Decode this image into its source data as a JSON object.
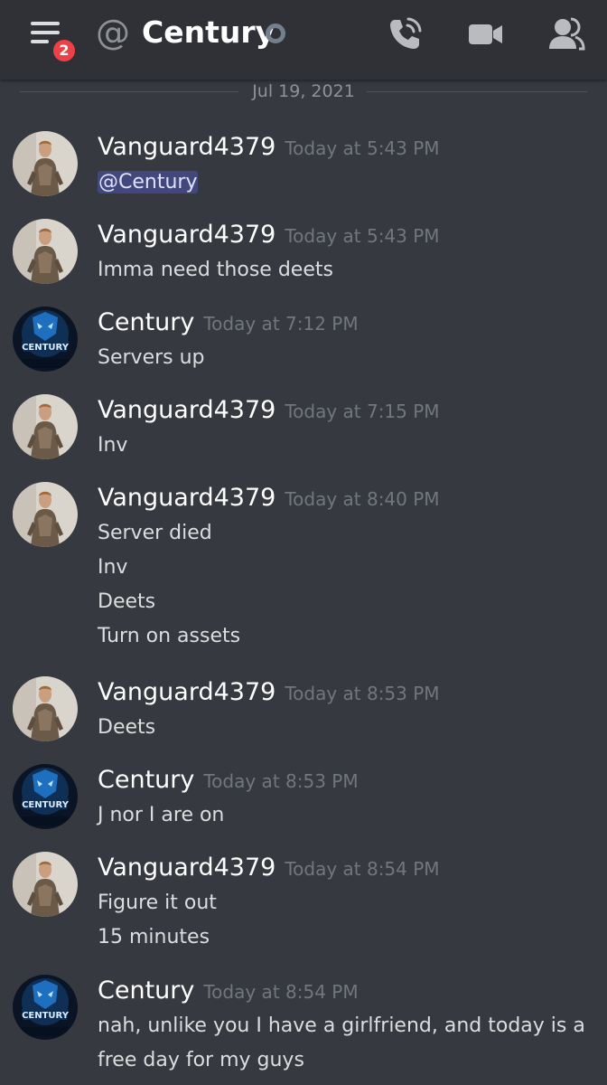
{
  "header": {
    "at_symbol": "@",
    "title": "Century",
    "badge_count": "2",
    "icons": [
      "menu-icon",
      "call-icon",
      "video-icon",
      "members-icon"
    ]
  },
  "divider": {
    "date": "Jul 19, 2021"
  },
  "messages": [
    {
      "author": "Vanguard4379",
      "avatar": "vanguard",
      "time": "Today at 5:43 PM",
      "lines": [
        "@Century"
      ]
    },
    {
      "author": "Vanguard4379",
      "avatar": "vanguard",
      "time": "Today at 5:43 PM",
      "lines": [
        "Imma need those deets"
      ]
    },
    {
      "author": "Century",
      "avatar": "century",
      "time": "Today at 7:12 PM",
      "lines": [
        "Servers up"
      ]
    },
    {
      "author": "Vanguard4379",
      "avatar": "vanguard",
      "time": "Today at 7:15 PM",
      "lines": [
        "Inv"
      ]
    },
    {
      "author": "Vanguard4379",
      "avatar": "vanguard",
      "time": "Today at 8:40 PM",
      "lines": [
        "Server died",
        "Inv",
        "Deets",
        "Turn on assets"
      ]
    },
    {
      "author": "Vanguard4379",
      "avatar": "vanguard",
      "time": "Today at 8:53 PM",
      "lines": [
        "Deets"
      ]
    },
    {
      "author": "Century",
      "avatar": "century",
      "time": "Today at 8:53 PM",
      "lines": [
        "J nor I are on"
      ]
    },
    {
      "author": "Vanguard4379",
      "avatar": "vanguard",
      "time": "Today at 8:54 PM",
      "lines": [
        "Figure it out",
        "15 minutes"
      ]
    },
    {
      "author": "Century",
      "avatar": "century",
      "time": "Today at 8:54 PM",
      "lines": [
        "nah, unlike you I have a girlfriend, and today is a",
        "free day for my guys"
      ]
    }
  ],
  "avatar_text": {
    "century": "CENTURY"
  },
  "colors": {
    "background": "#36393f",
    "header": "#2f3136",
    "badge": "#ed4245",
    "mention_bg": "#5865f2",
    "timestamp": "#72767d",
    "text": "#dcddde"
  }
}
